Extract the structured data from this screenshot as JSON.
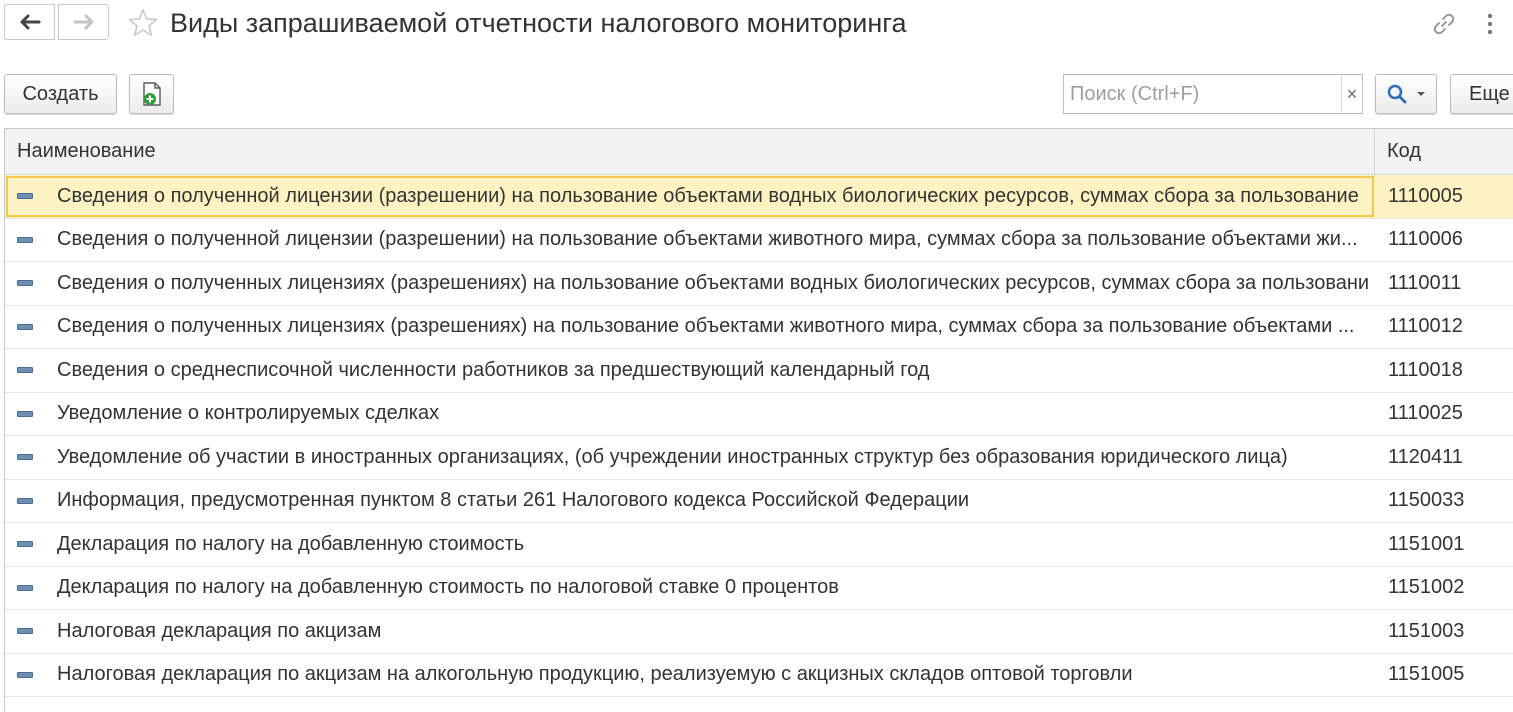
{
  "window": {
    "title": "Виды запрашиваемой отчетности налогового мониторинга",
    "back_icon": "arrow-left-icon",
    "forward_icon": "arrow-right-icon",
    "favorite_icon": "star-icon",
    "link_icon": "link-icon",
    "menu_icon": "more-vertical-icon"
  },
  "toolbar": {
    "create_label": "Создать",
    "copy_icon": "copy-add-icon",
    "search_placeholder": "Поиск (Ctrl+F)",
    "search_value": "",
    "clear_label": "×",
    "search_icon": "search-icon",
    "more_label": "Еще"
  },
  "table": {
    "columns": [
      "Наименование",
      "Код"
    ],
    "rows": [
      {
        "name": "Сведения о полученной лицензии (разрешении) на пользование объектами водных биологических ресурсов, суммах сбора за пользование",
        "code": "1110005"
      },
      {
        "name": "Сведения о полученной лицензии (разрешении) на пользование объектами животного мира, суммах сбора за пользование объектами жи...",
        "code": "1110006"
      },
      {
        "name": "Сведения о полученных лицензиях (разрешениях) на пользование объектами водных биологических ресурсов, суммах сбора за пользовани",
        "code": "1110011"
      },
      {
        "name": "Сведения о полученных лицензиях (разрешениях) на пользование объектами животного мира, суммах сбора за пользование объектами ...",
        "code": "1110012"
      },
      {
        "name": "Сведения о среднесписочной численности работников за предшествующий календарный год",
        "code": "1110018"
      },
      {
        "name": "Уведомление о контролируемых сделках",
        "code": "1110025"
      },
      {
        "name": "Уведомление об участии в иностранных организациях, (об учреждении иностранных структур без образования юридического лица)",
        "code": "1120411"
      },
      {
        "name": "Информация, предусмотренная пунктом 8 статьи 261 Налогового кодекса Российской Федерации",
        "code": "1150033"
      },
      {
        "name": "Декларация по налогу на добавленную стоимость",
        "code": "1151001"
      },
      {
        "name": "Декларация по налогу на добавленную стоимость по налоговой ставке 0 процентов",
        "code": "1151002"
      },
      {
        "name": "Налоговая декларация по акцизам",
        "code": "1151003"
      },
      {
        "name": "Налоговая декларация по акцизам на алкогольную продукцию, реализуемую с акцизных складов оптовой торговли",
        "code": "1151005"
      }
    ],
    "selected_row": 0,
    "row_icon": "catalog-item-icon"
  }
}
